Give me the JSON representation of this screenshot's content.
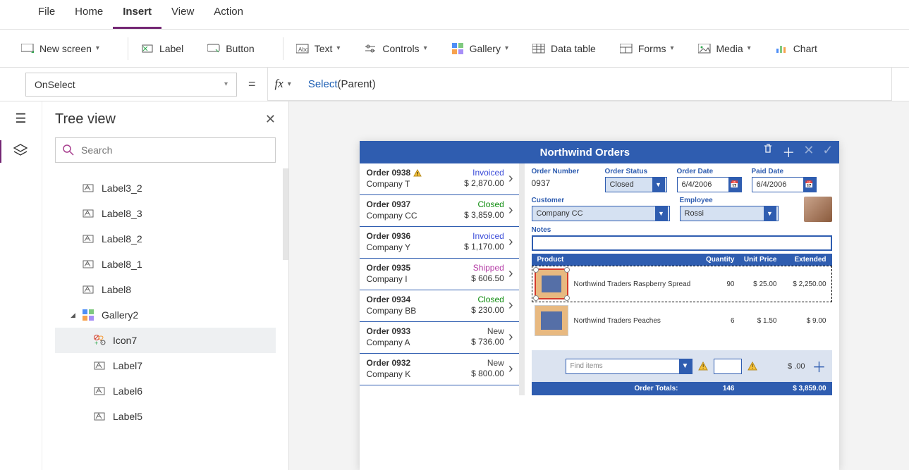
{
  "menu": {
    "items": [
      "File",
      "Home",
      "Insert",
      "View",
      "Action"
    ],
    "active": "Insert"
  },
  "ribbon": {
    "new_screen": "New screen",
    "label": "Label",
    "button": "Button",
    "text": "Text",
    "controls": "Controls",
    "gallery": "Gallery",
    "data_table": "Data table",
    "forms": "Forms",
    "media": "Media",
    "chart": "Chart"
  },
  "formula": {
    "property": "OnSelect",
    "fn": "Select",
    "arg": "Parent"
  },
  "tree": {
    "title": "Tree view",
    "search_placeholder": "Search",
    "nodes": [
      {
        "label": "Label3_2",
        "type": "label"
      },
      {
        "label": "Label8_3",
        "type": "label"
      },
      {
        "label": "Label8_2",
        "type": "label"
      },
      {
        "label": "Label8_1",
        "type": "label"
      },
      {
        "label": "Label8",
        "type": "label"
      },
      {
        "label": "Gallery2",
        "type": "gallery",
        "expanded": true,
        "children": [
          {
            "label": "Icon7",
            "type": "icon",
            "selected": true
          },
          {
            "label": "Label7",
            "type": "label"
          },
          {
            "label": "Label6",
            "type": "label"
          },
          {
            "label": "Label5",
            "type": "label"
          }
        ]
      }
    ]
  },
  "app": {
    "title": "Northwind Orders",
    "orders": [
      {
        "order": "Order 0938",
        "company": "Company T",
        "status": "Invoiced",
        "status_class": "invoiced",
        "amount": "$ 2,870.00",
        "warn": true
      },
      {
        "order": "Order 0937",
        "company": "Company CC",
        "status": "Closed",
        "status_class": "closed",
        "amount": "$ 3,859.00"
      },
      {
        "order": "Order 0936",
        "company": "Company Y",
        "status": "Invoiced",
        "status_class": "invoiced",
        "amount": "$ 1,170.00"
      },
      {
        "order": "Order 0935",
        "company": "Company I",
        "status": "Shipped",
        "status_class": "shipped",
        "amount": "$ 606.50"
      },
      {
        "order": "Order 0934",
        "company": "Company BB",
        "status": "Closed",
        "status_class": "closed",
        "amount": "$ 230.00"
      },
      {
        "order": "Order 0933",
        "company": "Company A",
        "status": "New",
        "status_class": "new",
        "amount": "$ 736.00"
      },
      {
        "order": "Order 0932",
        "company": "Company K",
        "status": "New",
        "status_class": "new",
        "amount": "$ 800.00"
      }
    ],
    "detail": {
      "order_number_label": "Order Number",
      "order_number": "0937",
      "order_status_label": "Order Status",
      "order_status": "Closed",
      "order_date_label": "Order Date",
      "order_date": "6/4/2006",
      "paid_date_label": "Paid Date",
      "paid_date": "6/4/2006",
      "customer_label": "Customer",
      "customer": "Company CC",
      "employee_label": "Employee",
      "employee": "Rossi",
      "notes_label": "Notes"
    },
    "prod_headers": {
      "product": "Product",
      "qty": "Quantity",
      "unit": "Unit Price",
      "ext": "Extended"
    },
    "products": [
      {
        "name": "Northwind Traders Raspberry Spread",
        "qty": "90",
        "unit": "$ 25.00",
        "ext": "$ 2,250.00",
        "selected": true
      },
      {
        "name": "Northwind Traders Peaches",
        "qty": "6",
        "unit": "$ 1.50",
        "ext": "$ 9.00"
      }
    ],
    "add": {
      "placeholder": "Find items",
      "ext": "$ .00"
    },
    "totals": {
      "label": "Order Totals:",
      "qty": "146",
      "ext": "$ 3,859.00"
    }
  }
}
